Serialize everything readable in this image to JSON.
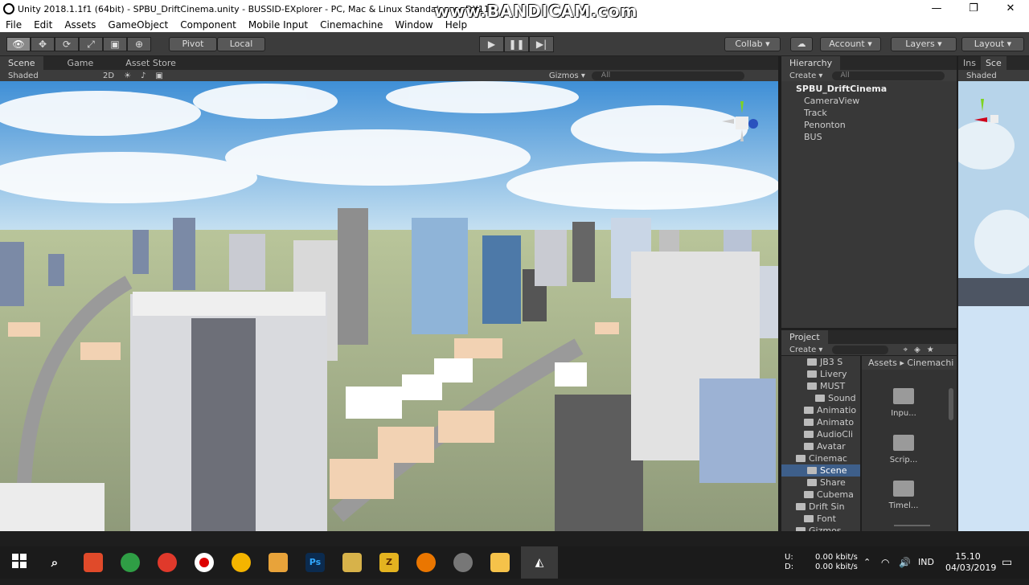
{
  "window": {
    "title": "Unity 2018.1.1f1 (64bit) - SPBU_DriftCinema.unity - BUSSID-EXplorer - PC, Mac & Linux Standalone <DX11>",
    "watermark": "www.BANDICAM.com",
    "minimize": "—",
    "maximize": "❐",
    "close": "✕"
  },
  "menu": [
    "File",
    "Edit",
    "Assets",
    "GameObject",
    "Component",
    "Mobile Input",
    "Cinemachine",
    "Window",
    "Help"
  ],
  "toolbar": {
    "tools": [
      "👁",
      "✥",
      "⟳",
      "⤢",
      "▣",
      "⊕"
    ],
    "pivot": "Pivot",
    "local": "Local",
    "play": "▶",
    "pause": "❚❚",
    "step": "▶|",
    "collab": "Collab ▾",
    "cloud": "☁",
    "account": "Account ▾",
    "layers": "Layers ▾",
    "layout": "Layout ▾"
  },
  "scene_tabs": {
    "scene": "Scene",
    "game": "Game",
    "asset_store": "Asset Store",
    "shaded": "Shaded",
    "twod": "2D",
    "gizmos": "Gizmos ▾",
    "search_placeholder": "All"
  },
  "hierarchy": {
    "tab": "Hierarchy",
    "create": "Create ▾",
    "search_placeholder": "All",
    "root": "SPBU_DriftCinema",
    "items": [
      "CameraView",
      "Track",
      "Penonton",
      "BUS"
    ]
  },
  "right_panel": {
    "tab1": "Ins",
    "tab2": "Sce",
    "shaded": "Shaded"
  },
  "project": {
    "tab": "Project",
    "create": "Create ▾",
    "breadcrumb_assets": "Assets",
    "breadcrumb_sep": "▸",
    "breadcrumb_current": "Cinemachi",
    "folders": [
      "JB3 S",
      "Livery",
      "MUST",
      "Sound",
      "Animatio",
      "Animato",
      "AudioCli",
      "Avatar",
      "Cinemac",
      "Scene",
      "Share",
      "Cubema",
      "Drift Sin",
      "Font",
      "Gizmos"
    ],
    "tiles": [
      "Inpu...",
      "Scrip...",
      "Timel..."
    ]
  },
  "taskbar": {
    "up_label": "U:",
    "down_label": "D:",
    "up_rate": "0.00 kbit/s",
    "down_rate": "0.00 kbit/s",
    "lang": "IND",
    "time": "15.10",
    "date": "04/03/2019",
    "apps": [
      "Ps",
      "Z"
    ]
  }
}
